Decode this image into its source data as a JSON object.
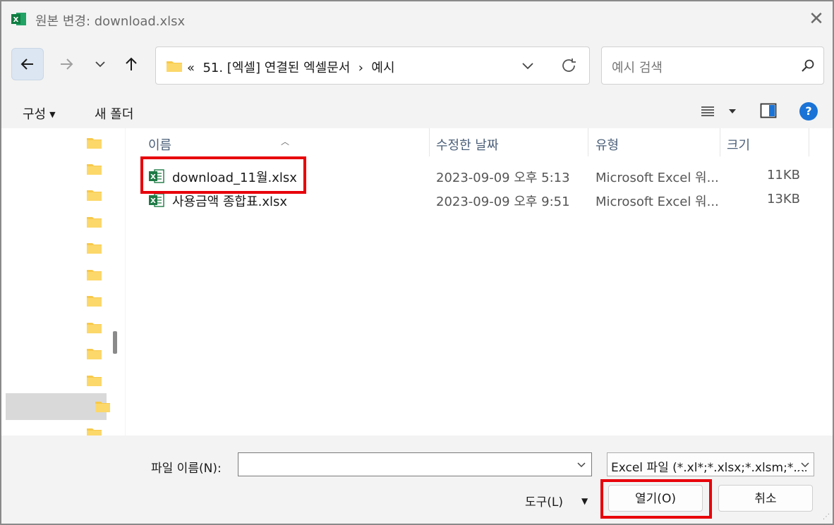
{
  "window": {
    "title": "원본 변경: download.xlsx"
  },
  "nav": {
    "breadcrumb": "«  51. [엑셀] 연결된 엑셀문서  ›  예시"
  },
  "search": {
    "placeholder": "예시 검색"
  },
  "commands": {
    "organize": "구성",
    "new_folder": "새 폴더"
  },
  "columns": {
    "name": "이름",
    "date": "수정한 날짜",
    "type": "유형",
    "size": "크기"
  },
  "files": [
    {
      "name": "download_11월.xlsx",
      "date": "2023-09-09 오후 5:13",
      "type": "Microsoft Excel 워...",
      "size": "11KB"
    },
    {
      "name": "사용금액 종합표.xlsx",
      "date": "2023-09-09 오후 9:51",
      "type": "Microsoft Excel 워...",
      "size": "13KB"
    }
  ],
  "footer": {
    "filename_label": "파일 이름(N):",
    "filename_value": "",
    "filetype": "Excel 파일 (*.xl*;*.xlsx;*.xlsm;*.xl",
    "tools": "도구(L)",
    "open": "열기(O)",
    "cancel": "취소"
  },
  "colors": {
    "accent": "#1a73d6",
    "highlight": "#e8000b",
    "folder": "#f8c94a",
    "excel": "#1d7a45"
  }
}
